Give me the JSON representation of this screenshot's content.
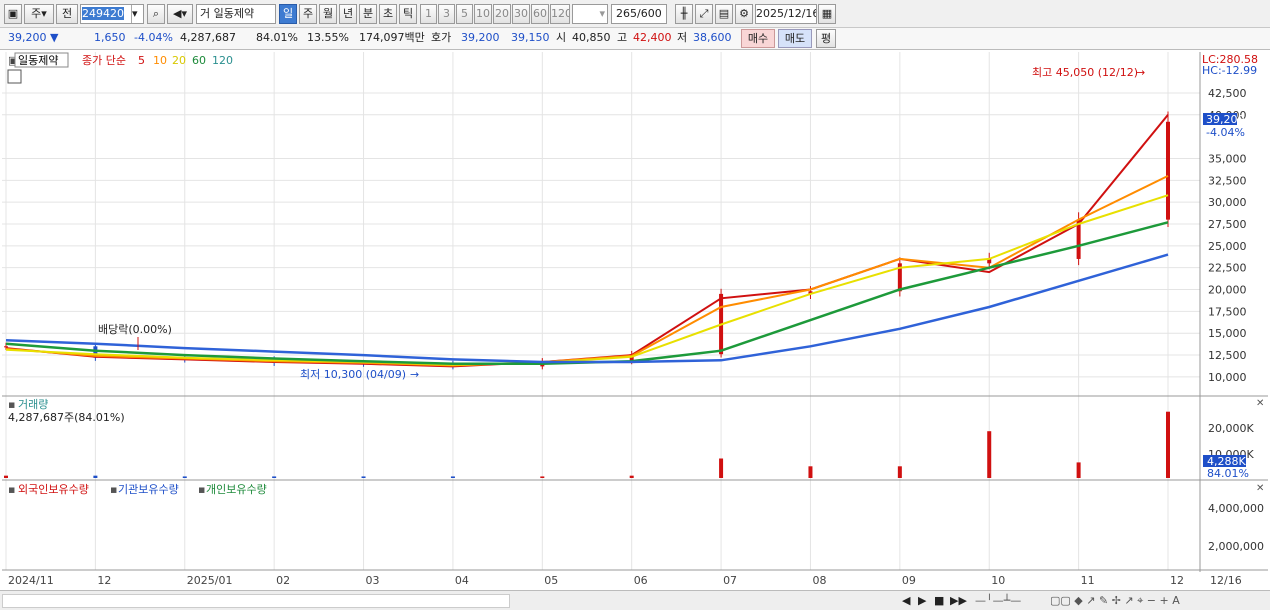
{
  "toolbar": {
    "type_btn": "주",
    "prev_btn": "전",
    "code": "249420",
    "market": "거",
    "name": "일동제약",
    "periods": [
      "일",
      "주",
      "월",
      "년",
      "분",
      "초",
      "틱"
    ],
    "minutes": [
      "1",
      "3",
      "5",
      "10",
      "20",
      "30",
      "60",
      "120"
    ],
    "count": "265",
    "count_max": "/600",
    "date": "2025/12/16"
  },
  "quote": {
    "price": "39,200 ▼",
    "change": "1,650",
    "rate": "-4.04%",
    "volume": "4,287,687",
    "vol_ratio": "84.01%",
    "turnover": "13.55%",
    "amount": "174,097백만",
    "bid_label": "호가",
    "ask": "39,200",
    "bid": "39,150",
    "open_label": "시",
    "open": "40,850",
    "high_label": "고",
    "high": "42,400",
    "low_label": "저",
    "low": "38,600",
    "buy": "매수",
    "sell": "매도",
    "avg": "평"
  },
  "legend": {
    "name": "일동제약",
    "title": "종가 단순",
    "ma": [
      "5",
      "10",
      "20",
      "60",
      "120"
    ]
  },
  "lc": "LC:280.58",
  "hc": "HC:-12.99",
  "cur_price": "39,200",
  "cur_rate": "-4.04%",
  "annotations": {
    "high": "최고 45,050 (12/12)",
    "low": "최저 10,300 (04/09)",
    "div": "배당락(0.00%)"
  },
  "vol_legend": {
    "title": "거래량",
    "value": "4,287,687주(84.01%)",
    "cur": "4,288K",
    "pct": "84.01%"
  },
  "hold_legend": {
    "a": "외국인보유수량",
    "b": "기관보유수량",
    "c": "개인보유수량"
  },
  "colors": {
    "up": "#d01010",
    "down": "#1e4fc8",
    "ma5": "#d01010",
    "ma10": "#ff8c00",
    "ma20": "#e8e000",
    "ma60": "#1d9a3a",
    "ma120": "#2f62d8"
  },
  "chart_data": {
    "type": "line",
    "x": [
      "2024-11",
      "2024-12",
      "2025-01",
      "2025-02",
      "2025-03",
      "2025-04",
      "2025-05",
      "2025-06",
      "2025-07",
      "2025-08",
      "2025-09",
      "2025-10",
      "2025-11",
      "2025-12"
    ],
    "x_labels": [
      "2024/11",
      "12",
      "2025/01",
      "02",
      "03",
      "04",
      "05",
      "06",
      "07",
      "08",
      "09",
      "10",
      "11",
      "12"
    ],
    "price_axis": [
      "42,500",
      "40,000",
      "35,000",
      "32,500",
      "30,000",
      "27,500",
      "25,000",
      "22,500",
      "20,000",
      "17,500",
      "15,000",
      "12,500",
      "10,000"
    ],
    "price_ylim": [
      8500,
      46500
    ],
    "series": [
      {
        "name": "종가",
        "values": [
          13500,
          12200,
          12000,
          11600,
          11500,
          11200,
          11800,
          12600,
          19500,
          19800,
          23000,
          23500,
          28000,
          39200
        ]
      },
      {
        "name": "5",
        "values": [
          13300,
          12300,
          12000,
          11700,
          11500,
          11200,
          11700,
          12500,
          19000,
          20000,
          23500,
          22000,
          27500,
          40000
        ]
      },
      {
        "name": "10",
        "values": [
          13200,
          12400,
          12100,
          11800,
          11600,
          11300,
          11700,
          12400,
          18000,
          20000,
          23500,
          22500,
          28000,
          33000
        ]
      },
      {
        "name": "20",
        "values": [
          13100,
          12600,
          12200,
          11900,
          11700,
          11400,
          11600,
          12300,
          16000,
          19500,
          22500,
          23500,
          27500,
          30800
        ]
      },
      {
        "name": "60",
        "values": [
          13800,
          13000,
          12500,
          12100,
          11800,
          11500,
          11500,
          11800,
          13000,
          16500,
          20000,
          22500,
          25000,
          27700
        ]
      },
      {
        "name": "120",
        "values": [
          14200,
          13800,
          13300,
          12900,
          12500,
          12000,
          11700,
          11700,
          11900,
          13500,
          15500,
          18000,
          21000,
          24000
        ]
      }
    ],
    "volume_axis": [
      "20,000K",
      "10,000K"
    ],
    "holdings_axis": [
      "4,000,000",
      "2,000,000"
    ]
  },
  "status": {
    "date_label": "12/16"
  }
}
